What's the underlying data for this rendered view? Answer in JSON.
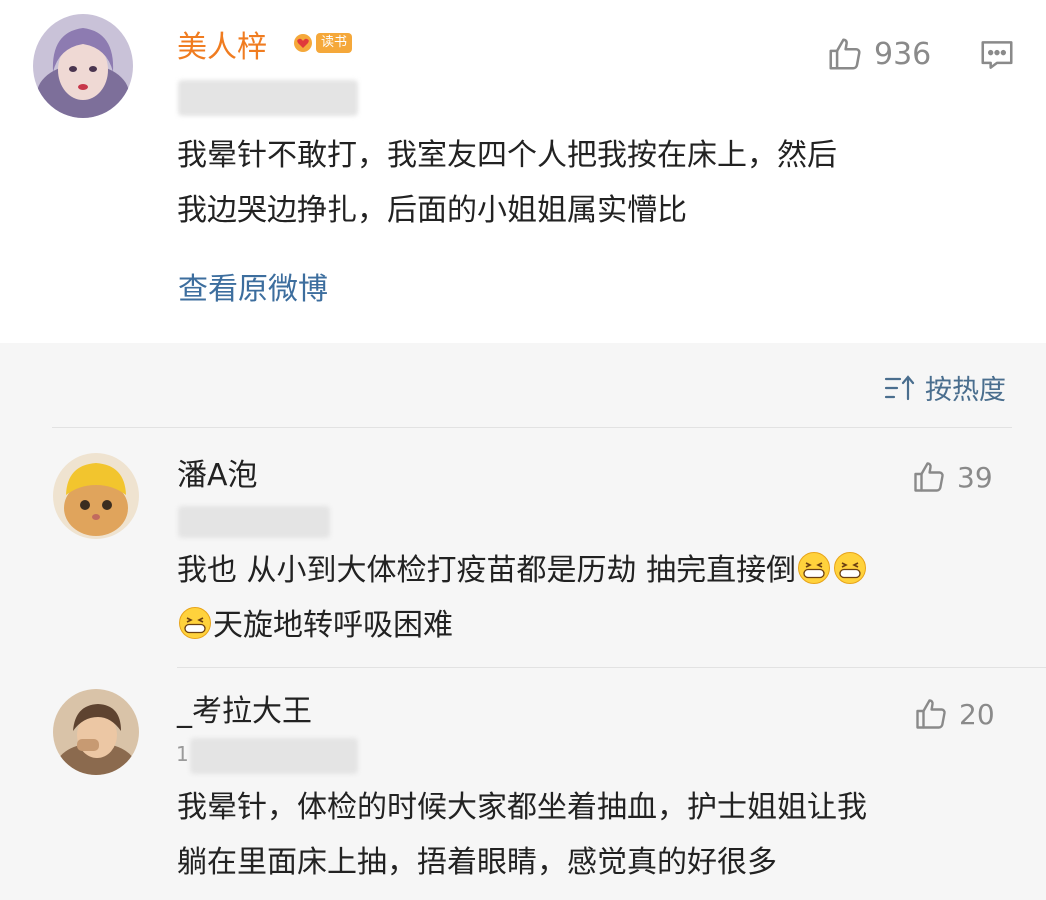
{
  "main_post": {
    "username": "美人梓",
    "badge_text": "读书",
    "likes": "936",
    "text_line1": "我晕针不敢打，我室友四个人把我按在床上，然后",
    "text_line2": "我边哭边挣扎，后面的小姐姐属实懵比",
    "view_original": "查看原微博"
  },
  "sort": {
    "label": "按热度",
    "icon": "sort-icon"
  },
  "comments": [
    {
      "username": "潘A泡",
      "likes": "39",
      "text_line1": "我也 从小到大体检打疫苗都是历劫 抽完直接倒",
      "text_line2": "天旋地转呼吸困难",
      "emoji": "grin-emoji"
    },
    {
      "username": "_考拉大王",
      "meta_visible": "1",
      "likes": "20",
      "text_line1": "我晕针，体检的时候大家都坐着抽血，护士姐姐让我",
      "text_line2": "躺在里面床上抽，捂着眼睛，感觉真的好很多"
    }
  ],
  "colors": {
    "username_orange": "#f07c20",
    "link_blue": "#3d6e9e",
    "gray_text": "#8a8a8a",
    "panel_bg": "#f6f6f6"
  }
}
